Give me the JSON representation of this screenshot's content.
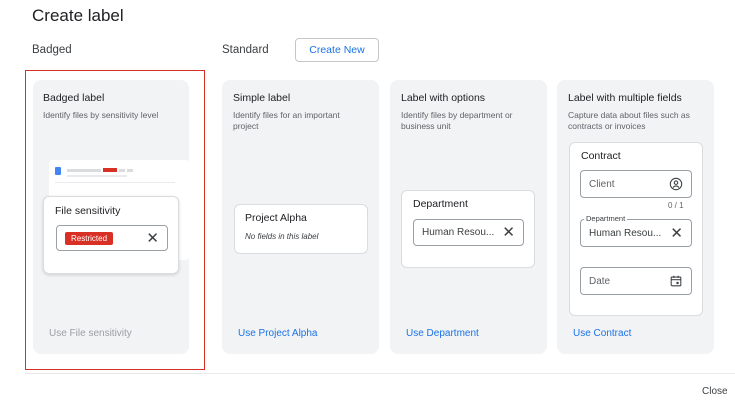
{
  "dialog": {
    "title": "Create label",
    "close_label": "Close"
  },
  "sections": {
    "badged": "Badged",
    "standard": "Standard",
    "create_new": "Create New"
  },
  "cards": {
    "badged": {
      "title": "Badged label",
      "desc": "Identify files by sensitivity level",
      "preview_title": "File sensitivity",
      "badge": "Restricted",
      "link": "Use File sensitivity"
    },
    "simple": {
      "title": "Simple label",
      "desc_line1": "Identify files for an important",
      "desc_line2": "project",
      "preview_title": "Project Alpha",
      "preview_note": "No fields in this label",
      "link": "Use Project Alpha"
    },
    "options": {
      "title": "Label with options",
      "desc_line1": "Identify files by department or",
      "desc_line2": "business unit",
      "preview_title": "Department",
      "preview_value": "Human Resou...",
      "link": "Use Department"
    },
    "multi": {
      "title": "Label with multiple fields",
      "desc_line1": "Capture data about files such as",
      "desc_line2": "contracts or invoices",
      "preview_title": "Contract",
      "client_placeholder": "Client",
      "counter": "0 / 1",
      "dept_label": "Department",
      "dept_value": "Human Resou...",
      "date_placeholder": "Date",
      "link": "Use Contract"
    }
  }
}
